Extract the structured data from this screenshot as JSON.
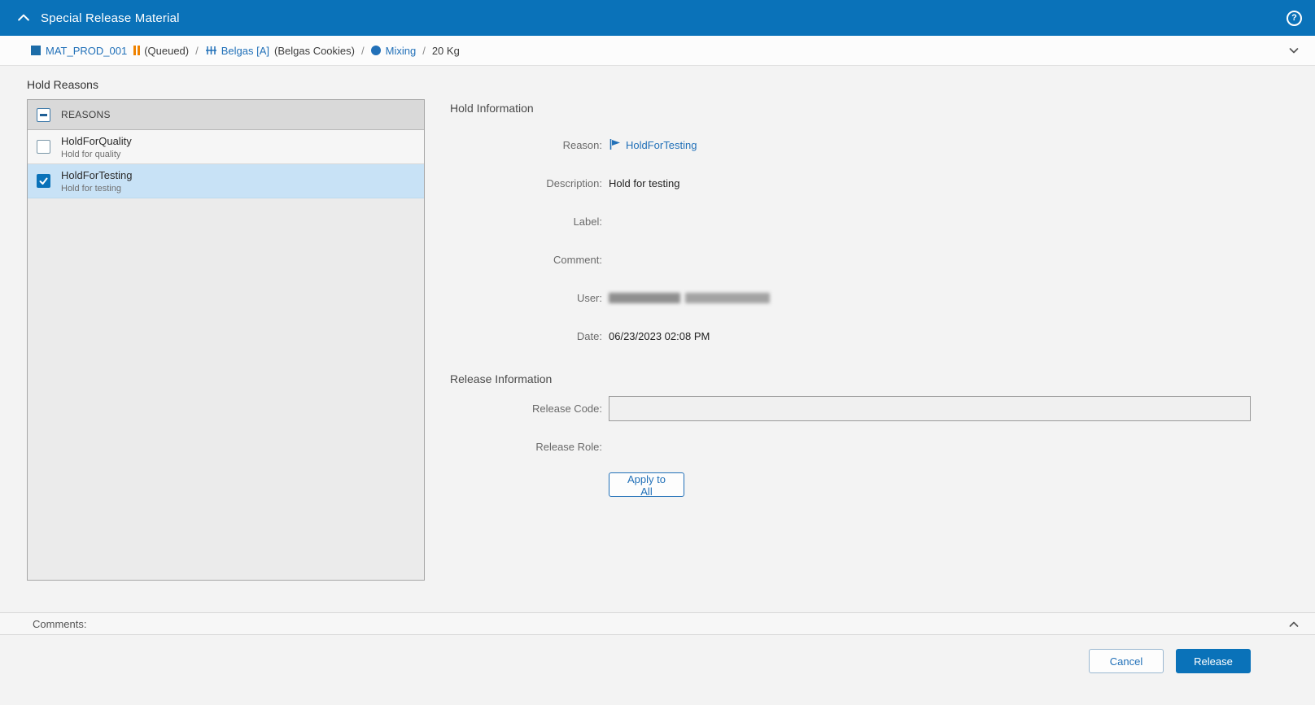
{
  "colors": {
    "header_blue": "#0a72b9",
    "link_blue": "#2170b8",
    "selected_row_blue": "#c8e2f6",
    "status_orange": "#ef8200"
  },
  "header": {
    "title": "Special Release Material",
    "help_glyph": "?"
  },
  "breadcrumb": {
    "material": "MAT_PROD_001",
    "status": "(Queued)",
    "separator": "/",
    "equipment": "Belgas [A]",
    "equipment_desc": "(Belgas Cookies)",
    "operation": "Mixing",
    "quantity": "20 Kg"
  },
  "hold_reasons": {
    "title": "Hold Reasons",
    "header_label": "REASONS",
    "items": [
      {
        "name": "HoldForQuality",
        "description": "Hold for quality",
        "checked": false,
        "selected": false
      },
      {
        "name": "HoldForTesting",
        "description": "Hold for testing",
        "checked": true,
        "selected": true
      }
    ]
  },
  "hold_info": {
    "title": "Hold Information",
    "fields": [
      {
        "label": "Reason:",
        "value": "HoldForTesting"
      },
      {
        "label": "Description:",
        "value": "Hold for testing"
      },
      {
        "label": "Label:",
        "value": ""
      },
      {
        "label": "Comment:",
        "value": ""
      },
      {
        "label": "User:",
        "value": "",
        "redacted": true
      },
      {
        "label": "Date:",
        "value": "06/23/2023 02:08 PM"
      }
    ]
  },
  "release_info": {
    "title": "Release Information",
    "code_label": "Release Code:",
    "code_value": "",
    "role_label": "Release Role:",
    "role_value": "",
    "apply_button": "Apply to All"
  },
  "comments": {
    "label": "Comments:"
  },
  "footer": {
    "cancel": "Cancel",
    "release": "Release"
  }
}
